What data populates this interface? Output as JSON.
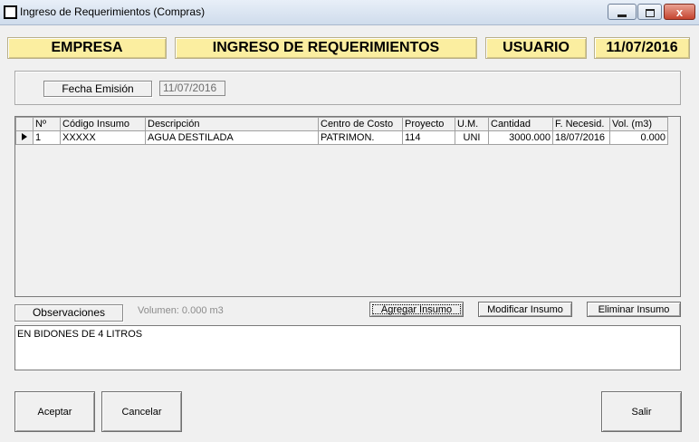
{
  "window": {
    "title": "Ingreso de Requerimientos (Compras)",
    "close_glyph": "x"
  },
  "header": {
    "empresa": "EMPRESA",
    "title": "INGRESO DE REQUERIMIENTOS",
    "usuario": "USUARIO",
    "date": "11/07/2016"
  },
  "emission": {
    "label": "Fecha Emisión",
    "value": "11/07/2016"
  },
  "grid": {
    "columns": [
      "Nº",
      "Código Insumo",
      "Descripción",
      "Centro de Costo",
      "Proyecto",
      "U.M.",
      "Cantidad",
      "F. Necesid.",
      "Vol. (m3)"
    ],
    "rows": [
      {
        "n": "1",
        "codigo": "XXXXX",
        "descripcion": "AGUA DESTILADA",
        "centro": "PATRIMON.",
        "proyecto": "114",
        "um": "UNI",
        "cantidad": "3000.000",
        "fecha": "18/07/2016",
        "vol": "0.000"
      }
    ]
  },
  "observations": {
    "label": "Observaciones",
    "volume": "Volumen: 0.000 m3",
    "text": "EN BIDONES DE 4 LITROS"
  },
  "actions": {
    "add": "Agregar Insumo",
    "modify": "Modificar Insumo",
    "delete": "Eliminar Insumo"
  },
  "footer": {
    "accept": "Aceptar",
    "cancel": "Cancelar",
    "exit": "Salir"
  }
}
